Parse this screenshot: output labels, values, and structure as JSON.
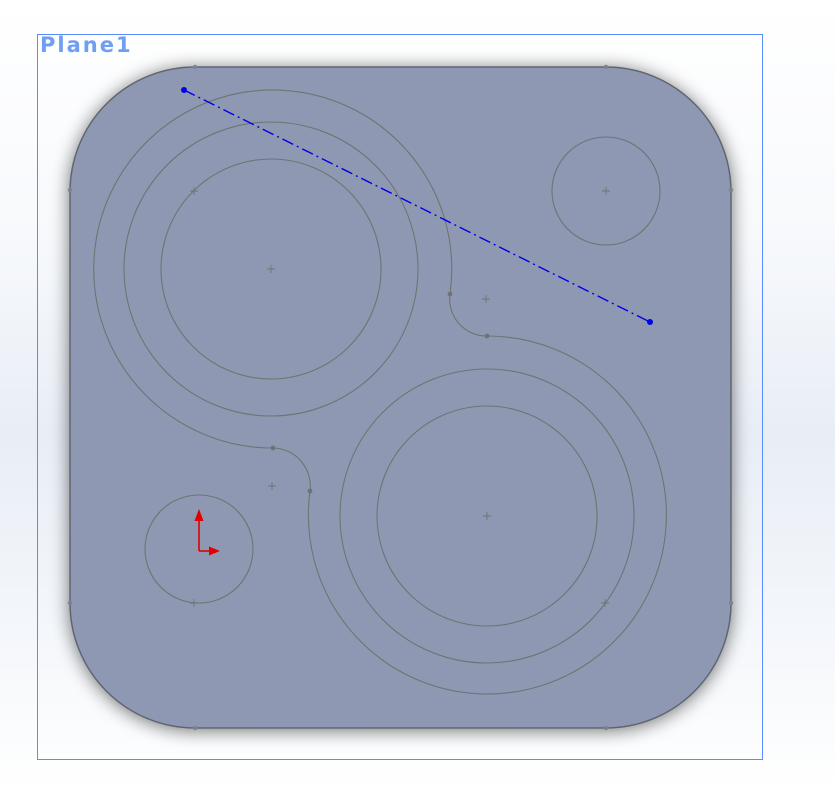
{
  "plane": {
    "label": "Plane1",
    "frame_color": "#5a8cff",
    "label_color": "#6f9ef2"
  },
  "part": {
    "face_color": "#8f99b3",
    "sketch_color": "#6e7473",
    "edge_color": "#5e6570"
  },
  "axis_line": {
    "color": "#0000e6",
    "style": "dash-dot"
  },
  "origin": {
    "color": "#e00000"
  },
  "icons": [
    "origin-triad-icon",
    "center-mark-icon"
  ]
}
